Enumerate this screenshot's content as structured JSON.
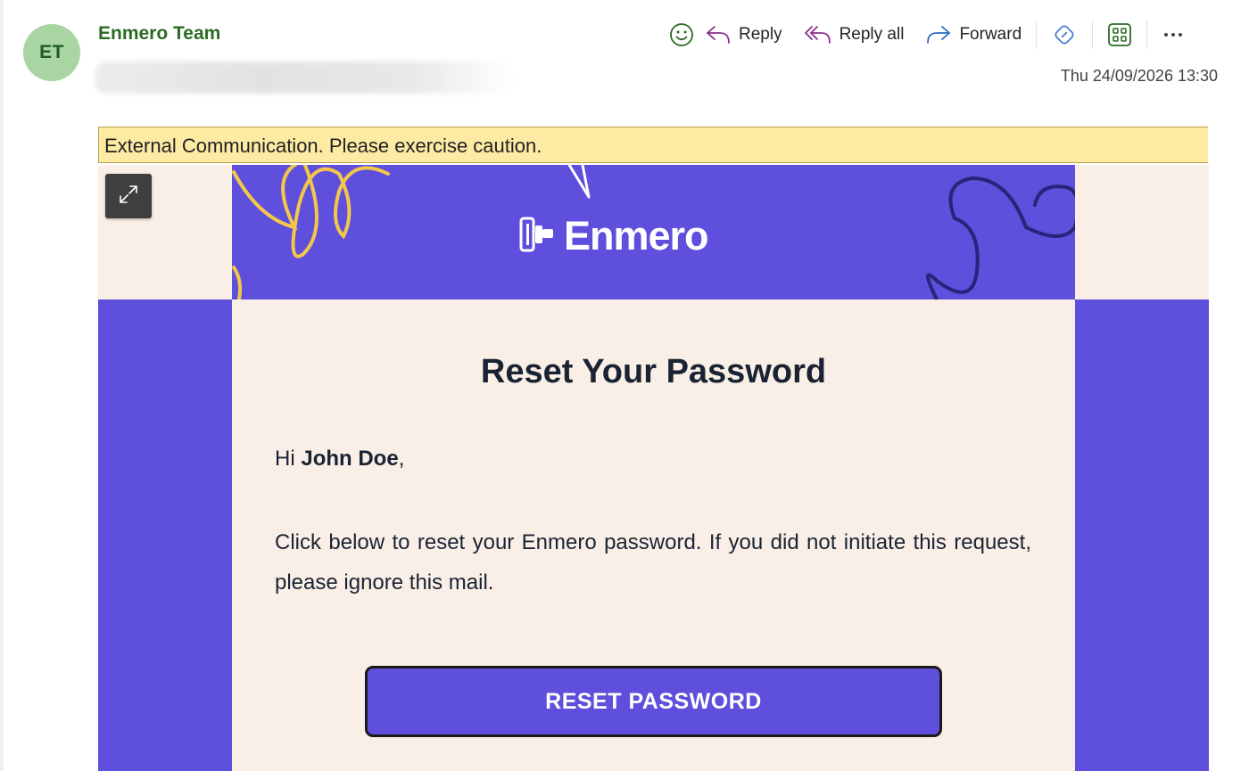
{
  "sender": {
    "initials": "ET",
    "name": "Enmero Team"
  },
  "toolbar": {
    "reply_label": "Reply",
    "reply_all_label": "Reply all",
    "forward_label": "Forward"
  },
  "date": "Thu 24/09/2026 13:30",
  "banner": "External Communication. Please exercise caution.",
  "email": {
    "brand": "Enmero",
    "title": "Reset Your Password",
    "greeting_prefix": "Hi ",
    "recipient": "John Doe",
    "greeting_suffix": ",",
    "body": "Click below to reset your Enmero password. If you did not initiate this request, please ignore this mail.",
    "cta": "RESET PASSWORD"
  },
  "icons": [
    "smiley-icon",
    "reply-icon",
    "reply-all-icon",
    "forward-icon",
    "tag-icon",
    "apps-icon",
    "more-icon",
    "expand-icon",
    "enmero-logo-icon"
  ],
  "colors": {
    "brand_purple": "#5e4fdc",
    "cream": "#f9efe6",
    "banner_yellow": "#fdeba4",
    "sender_green": "#2b6b23"
  }
}
